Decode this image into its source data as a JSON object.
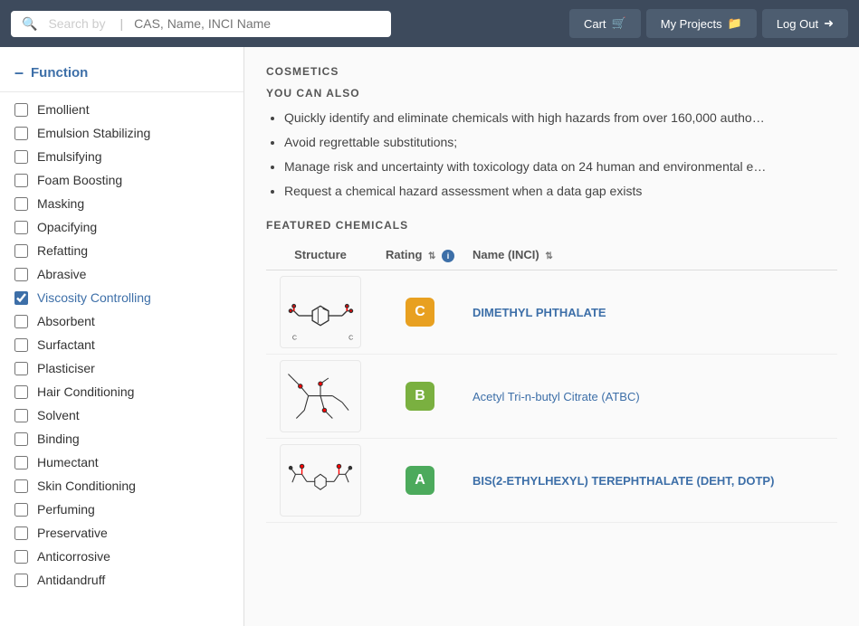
{
  "header": {
    "search_placeholder": "CAS, Name, INCI Name",
    "search_by_label": "Search by",
    "cart_label": "Cart",
    "my_projects_label": "My Projects",
    "log_out_label": "Log Out"
  },
  "sidebar": {
    "section_label": "Function",
    "items": [
      {
        "id": "emollient",
        "label": "Emollient",
        "checked": false
      },
      {
        "id": "emulsion-stabilizing",
        "label": "Emulsion Stabilizing",
        "checked": false
      },
      {
        "id": "emulsifying",
        "label": "Emulsifying",
        "checked": false
      },
      {
        "id": "foam-boosting",
        "label": "Foam Boosting",
        "checked": false
      },
      {
        "id": "masking",
        "label": "Masking",
        "checked": false
      },
      {
        "id": "opacifying",
        "label": "Opacifying",
        "checked": false
      },
      {
        "id": "refatting",
        "label": "Refatting",
        "checked": false
      },
      {
        "id": "abrasive",
        "label": "Abrasive",
        "checked": false
      },
      {
        "id": "viscosity-controlling",
        "label": "Viscosity Controlling",
        "checked": true
      },
      {
        "id": "absorbent",
        "label": "Absorbent",
        "checked": false
      },
      {
        "id": "surfactant",
        "label": "Surfactant",
        "checked": false
      },
      {
        "id": "plasticiser",
        "label": "Plasticiser",
        "checked": false
      },
      {
        "id": "hair-conditioning",
        "label": "Hair Conditioning",
        "checked": false
      },
      {
        "id": "solvent",
        "label": "Solvent",
        "checked": false
      },
      {
        "id": "binding",
        "label": "Binding",
        "checked": false
      },
      {
        "id": "humectant",
        "label": "Humectant",
        "checked": false
      },
      {
        "id": "skin-conditioning",
        "label": "Skin Conditioning",
        "checked": false
      },
      {
        "id": "perfuming",
        "label": "Perfuming",
        "checked": false
      },
      {
        "id": "preservative",
        "label": "Preservative",
        "checked": false
      },
      {
        "id": "anticorrosive",
        "label": "Anticorrosive",
        "checked": false
      },
      {
        "id": "antidandruff",
        "label": "Antidandruff",
        "checked": false
      }
    ]
  },
  "main": {
    "cosmetics_title": "COSMETICS",
    "you_can_also_title": "YOU CAN ALSO",
    "bullets": [
      "Quickly identify and eliminate chemicals with high hazards from over 160,000 autho…",
      "Avoid regrettable substitutions;",
      "Manage risk and uncertainty with toxicology data on 24 human and environmental e…",
      "Request a chemical hazard assessment when a data gap exists"
    ],
    "featured_title": "FEATURED CHEMICALS",
    "table": {
      "col_structure": "Structure",
      "col_rating": "Rating",
      "col_name": "Name (INCI)",
      "rows": [
        {
          "id": "dimethyl-phthalate",
          "rating": "C",
          "rating_class": "rating-c",
          "name": "DIMETHYL PHTHALATE",
          "name_class": "chem-name-c"
        },
        {
          "id": "acetyl-tributyl-citrate",
          "rating": "B",
          "rating_class": "rating-b",
          "name": "Acetyl Tri-n-butyl Citrate (ATBC)",
          "name_class": "chem-name-b"
        },
        {
          "id": "bis2ethylhexyl",
          "rating": "A",
          "rating_class": "rating-a",
          "name": "BIS(2-ETHYLHEXYL) TEREPHTHALATE (DEHT, DOTP)",
          "name_class": "chem-name-a"
        }
      ]
    }
  }
}
